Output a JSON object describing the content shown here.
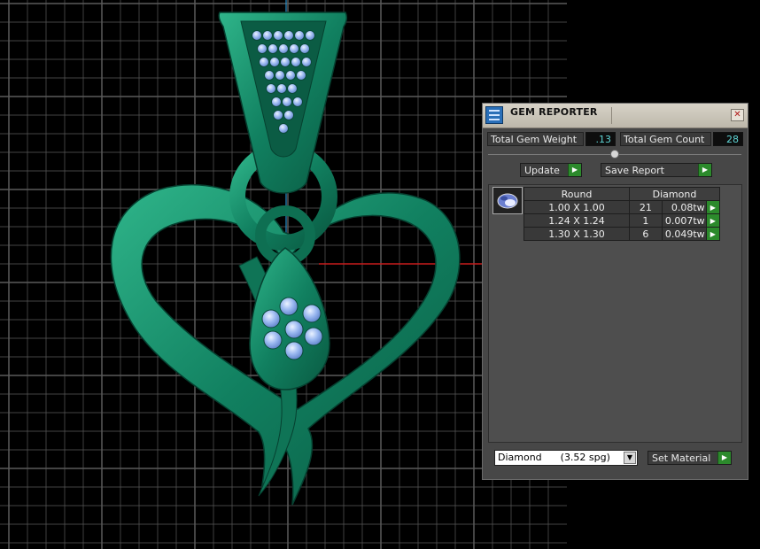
{
  "panel": {
    "title": "GEM REPORTER",
    "close_glyph": "✕",
    "total_weight_label": "Total Gem Weight",
    "total_weight_value": ".13",
    "total_count_label": "Total Gem Count",
    "total_count_value": "28",
    "update_label": "Update",
    "save_report_label": "Save Report",
    "go_glyph": "▶",
    "gem_shape_header": "Round",
    "gem_material_header": "Diamond",
    "rows": [
      {
        "size": "1.00 X 1.00",
        "count": "21",
        "weight": "0.08tw"
      },
      {
        "size": "1.24 X 1.24",
        "count": "1",
        "weight": "0.007tw"
      },
      {
        "size": "1.30 X 1.30",
        "count": "6",
        "weight": "0.049tw"
      }
    ],
    "material_select": "Diamond      (3.52 spg)",
    "set_material_label": "Set Material"
  },
  "colors": {
    "metal": "#118060",
    "gem": "#9ab8f0",
    "grid": "#5a5a5a",
    "axis_red": "#c81c1c",
    "axis_blue": "#2a90c8"
  },
  "icons": {
    "app": "gem-reporter-icon",
    "thumb": "round-gem-icon"
  }
}
